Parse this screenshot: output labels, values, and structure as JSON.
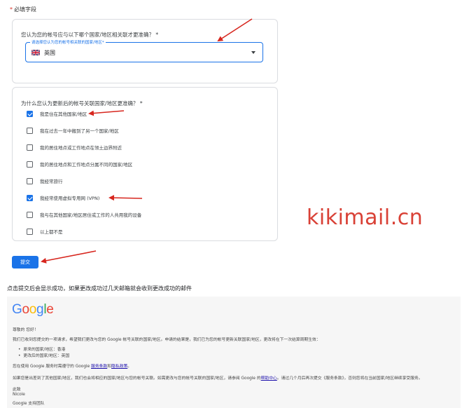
{
  "form": {
    "required_star": "*",
    "required_text": "必填字段",
    "q1": {
      "label": "您认为您的帐号应与以下哪个国家/地区相关联才更准确？ *",
      "select_floating_label": "请选择您认为您的帐号相关联的国家/地区*",
      "selected_value": "英国",
      "flag_icon": "uk-flag-icon"
    },
    "q2": {
      "label": "为什么您认为更新后的帐号关联国家/地区更准确？ *",
      "options": [
        {
          "label": "我是住在其他国家/地区",
          "checked": true
        },
        {
          "label": "我在过去一年中搬到了另一个国家/地区",
          "checked": false
        },
        {
          "label": "我的居住地点或工作地点在领土边界附近",
          "checked": false
        },
        {
          "label": "我的居住地点和工作地点分属不同的国家/地区",
          "checked": false
        },
        {
          "label": "我经常旅行",
          "checked": false
        },
        {
          "label": "我经常使用虚拟专用网 (VPN)",
          "checked": true
        },
        {
          "label": "我与在其他国家/地区居住或工作的人共用我的设备",
          "checked": false
        },
        {
          "label": "以上都不是",
          "checked": false
        }
      ]
    },
    "submit_label": "提交"
  },
  "watermark": "kikimail.cn",
  "caption": "点击提交后会显示成功，如果更改成功过几天邮箱就会收到更改成功的邮件",
  "email": {
    "logo": {
      "G": "G",
      "o1": "o",
      "o2": "o",
      "g": "g",
      "l": "l",
      "e": "e"
    },
    "greeting": "尊敬的 您好！",
    "p1": "我们已收到您提交的一项请求，希望我们更改与您的 Google 帐号关联的国家/地区。申请的结果是，我们已为您的帐号更新关联国家/地区，更改将在下一次结算周期生效：",
    "bullets": [
      "原来的国家/地区：香港",
      "更改后的国家/地区：英国"
    ],
    "p2_prefix": "您在使用 Google 服务时需遵守的 Google ",
    "p2_link1": "服务条款",
    "p2_mid": "和",
    "p2_link2": "隐私政策",
    "p2_suffix": "。",
    "p3_prefix": "如果您是出差到了其他国家/地区，我们也会将相应的国家/地区与您的帐号关联。如需更改与您的帐号关联的国家/地区，请参阅 Google 的",
    "p3_link": "帮助中心",
    "p3_suffix": "。请过几个月后再次提交《服务条款》，否则您将在当前国家/地区继续享受服务。",
    "closing": "此致",
    "signature_name": "Nicole",
    "signature_team": "Google 支持团队"
  },
  "colors": {
    "accent": "#1a73e8",
    "arrow": "#d7261e",
    "watermark": "#d94136"
  }
}
